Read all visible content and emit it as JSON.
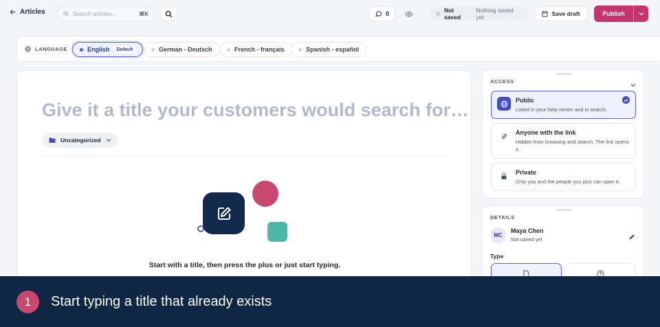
{
  "topbar": {
    "back_label": "Articles",
    "search_placeholder": "Search articles...",
    "search_shortcut": "⌘K",
    "comment_count": "0",
    "status_main": "Not saved",
    "status_sub": "Nothing saved yet",
    "save_draft_label": "Save draft",
    "publish_label": "Publish",
    "publish_color": "#c2366c"
  },
  "language": {
    "label": "LANGUAGE",
    "default_tag": "Default",
    "items": [
      {
        "label": "English"
      },
      {
        "label": "German - Deutsch"
      },
      {
        "label": "French - français"
      },
      {
        "label": "Spanish - español"
      }
    ]
  },
  "editor": {
    "title_placeholder": "Give it a title your customers would search for…",
    "category_label": "Uncategorized",
    "hint": "Start with a title, then press the plus or just start typing."
  },
  "access": {
    "title": "ACCESS",
    "options": [
      {
        "title": "Public",
        "desc": "Listed in your help center and in search.",
        "icon": "globe-icon",
        "selected": true
      },
      {
        "title": "Anyone with the link",
        "desc": "Hidden from browsing and search. The link opens it.",
        "icon": "link-icon",
        "selected": false
      },
      {
        "title": "Private",
        "desc": "Only you and the people you pick can open it.",
        "icon": "lock-icon",
        "selected": false
      }
    ]
  },
  "details": {
    "title": "DETAILS",
    "initials": "MC",
    "name": "Maya Chen",
    "sub": "Not saved yet",
    "type_label": "Type"
  },
  "caption": {
    "step": "1",
    "text": "Start typing a title that already exists"
  }
}
